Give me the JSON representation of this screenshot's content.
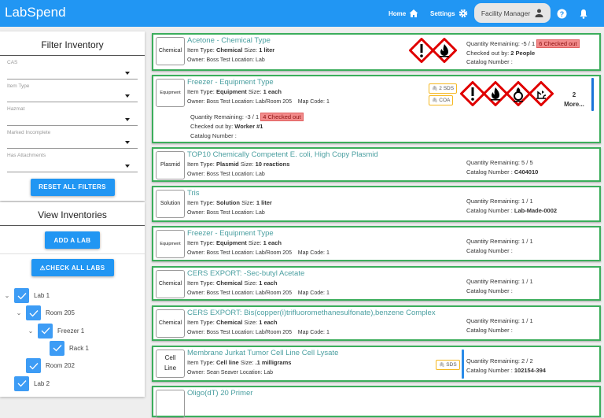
{
  "header": {
    "logo": "LabSpend",
    "home": "Home",
    "settings": "Settings",
    "user": "Facility Manager"
  },
  "filter": {
    "title": "Filter Inventory",
    "fields": [
      "CAS",
      "Item Type",
      "Hazmat",
      "Marked Incomplete",
      "Has Attachments"
    ],
    "reset": "RESET ALL FILTERS"
  },
  "inventories": {
    "title": "View Inventories",
    "add_lab": "ADD A LAB",
    "check_all": "⚠CHECK ALL LABS",
    "tree": [
      {
        "label": "Lab 1",
        "level": 0,
        "expanded": true,
        "checked": true
      },
      {
        "label": "Room 205",
        "level": 1,
        "expanded": true,
        "checked": true
      },
      {
        "label": "Freezer 1",
        "level": 2,
        "expanded": true,
        "checked": true
      },
      {
        "label": "Rack 1",
        "level": 3,
        "expanded": false,
        "checked": true
      },
      {
        "label": "Room 202",
        "level": 1,
        "expanded": false,
        "checked": true
      },
      {
        "label": "Lab 2",
        "level": 0,
        "expanded": false,
        "checked": true
      }
    ]
  },
  "items": [
    {
      "thumb": "Chemical",
      "title": "Acetone - Chemical Type",
      "type": "Chemical",
      "size": "1 liter",
      "owner": "Boss Test",
      "location": "Lab",
      "map": "",
      "qty": "-5 / 1",
      "checked_out": "6 Checked out",
      "checked_by": "2 People",
      "catalog": "",
      "hazards": [
        "exclamation",
        "flame"
      ],
      "attachments": []
    },
    {
      "thumb": "Equipment",
      "title": "Freezer - Equipment Type",
      "type": "Equipment",
      "size": "1 each",
      "owner": "Boss Test",
      "location": "Lab/Room 205",
      "map": "1",
      "qty": "-3 / 1",
      "checked_out": "4 Checked out",
      "checked_by": "Worker #1",
      "catalog": "",
      "hazards": [
        "exclamation",
        "flame",
        "flame-over-circle",
        "environment"
      ],
      "more": "2 More...",
      "attachments": [
        "2 SDS",
        "COA"
      ]
    },
    {
      "thumb": "Plasmid",
      "title": "TOP10 Chemically Competent E. coli, High Copy Plasmid",
      "type": "Plasmid",
      "size": "10 reactions",
      "owner": "Boss Test",
      "location": "Lab",
      "map": "",
      "qty": "5 / 5",
      "catalog": "C404010",
      "hazards": [],
      "attachments": []
    },
    {
      "thumb": "Solution",
      "title": "Tris",
      "type": "Solution",
      "size": "1 liter",
      "owner": "Boss Test",
      "location": "Lab",
      "map": "",
      "qty": "1 / 1",
      "catalog": "Lab-Made-0002",
      "hazards": [],
      "attachments": []
    },
    {
      "thumb": "Equipment",
      "title": "Freezer - Equipment Type",
      "type": "Equipment",
      "size": "1 each",
      "owner": "Boss Test",
      "location": "Lab/Room 205",
      "map": "1",
      "qty": "1 / 1",
      "catalog": "",
      "hazards": [],
      "attachments": []
    },
    {
      "thumb": "Chemical",
      "title": "CERS EXPORT: -Sec-butyl Acetate",
      "type": "Chemical",
      "size": "1 each",
      "owner": "Boss Test",
      "location": "Lab/Room 205",
      "map": "1",
      "qty": "1 / 1",
      "catalog": "",
      "hazards": [],
      "attachments": []
    },
    {
      "thumb": "Chemical",
      "title": "CERS EXPORT: Bis(copper(i)trifluoromethanesulfonate),benzene Complex",
      "type": "Chemical",
      "size": "1 each",
      "owner": "Boss Test",
      "location": "Lab/Room 205",
      "map": "1",
      "qty": "1 / 1",
      "catalog": "",
      "hazards": [],
      "attachments": []
    },
    {
      "thumb": "Cell Line",
      "title": "Membrane Jurkat Tumor Cell Line Cell Lysate",
      "type": "Cell line",
      "size": ".1 milligrams",
      "owner": "Sean Seaver",
      "location": "Lab",
      "map": "",
      "qty": "2 / 2",
      "catalog": "102154-394",
      "hazards": [],
      "attachments": [
        "SDS"
      ]
    },
    {
      "thumb": "",
      "title": "Oligo(dT) 20 Primer",
      "type": "",
      "size": "",
      "owner": "",
      "location": "",
      "map": "",
      "qty": "",
      "catalog": "",
      "hazards": [],
      "attachments": []
    }
  ],
  "labels": {
    "item_type": "Item Type: ",
    "size": "Size: ",
    "owner": "Owner: ",
    "location": "Location: ",
    "map": "Map Code: ",
    "qty": "Quantity Remaining: ",
    "checked_by": "Checked out by: ",
    "catalog": "Catalog Number : "
  },
  "colors": {
    "brand": "#2196f3",
    "card_border": "#3cae5c",
    "title": "#4a9fa0",
    "hazard": "#e00000"
  }
}
